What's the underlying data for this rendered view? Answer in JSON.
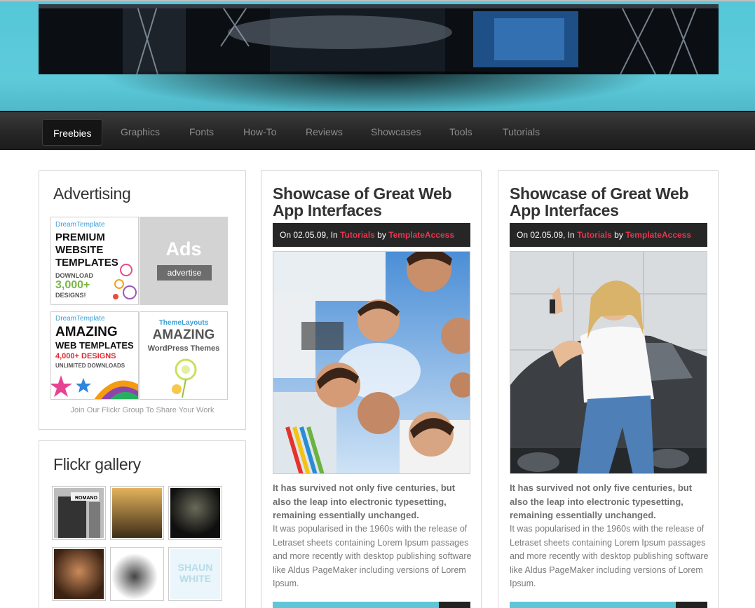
{
  "nav": {
    "items": [
      "Freebies",
      "Graphics",
      "Fonts",
      "How-To",
      "Reviews",
      "Showcases",
      "Tools",
      "Tutorials"
    ],
    "active": "Freebies"
  },
  "advertising": {
    "title": "Advertising",
    "ads": [
      {
        "brand": "DreamTemplate",
        "lines": [
          "PREMIUM",
          "WEBSITE",
          "TEMPLATES"
        ],
        "sub": "DOWNLOAD",
        "count": "3,000+",
        "tail": "DESIGNS!"
      },
      {
        "big": "Ads",
        "button": "advertise"
      },
      {
        "brand": "DreamTemplate",
        "lines": [
          "AMAZING",
          "WEB TEMPLATES"
        ],
        "count": "4,000+ DESIGNS",
        "tail": "UNLIMITED DOWNLOADS"
      },
      {
        "brand": "ThemeLayouts",
        "big": "AMAZING",
        "sub": "WordPress Themes"
      }
    ],
    "flickr_link": "Join Our Flickr Group To Share Your Work"
  },
  "flickr": {
    "title": "Flickr gallery",
    "thumb_labels": [
      "ROMANO",
      "SHAUN WHITE"
    ]
  },
  "posts": [
    {
      "title": "Showcase of Great Web App Interfaces",
      "meta_prefix": "On 02.05.09, In ",
      "category": "Tutorials",
      "by": " by ",
      "author": "TemplateAccess",
      "excerpt_bold": "It has survived not only five centuries, but also the leap into electronic typesetting, remaining essentially unchanged.",
      "excerpt": "It was popularised in the 1960s with the release of Letraset sheets containing Lorem Ipsum passages and more recently with desktop publishing software like Aldus PageMaker including versions of Lorem Ipsum."
    },
    {
      "title": "Showcase of Great Web App Interfaces",
      "meta_prefix": "On 02.05.09, In ",
      "category": "Tutorials",
      "by": " by ",
      "author": "TemplateAccess",
      "excerpt_bold": "It has survived not only five centuries, but also the leap into electronic typesetting, remaining essentially unchanged.",
      "excerpt": "It was popularised in the 1960s with the release of Letraset sheets containing Lorem Ipsum passages and more recently with desktop publishing software like Aldus PageMaker including versions of Lorem Ipsum."
    }
  ],
  "colors": {
    "header_cyan": "#5ecbdb",
    "nav_dark": "#262626",
    "accent_red": "#e8344d",
    "readbar_cyan": "#5ec6d6"
  }
}
